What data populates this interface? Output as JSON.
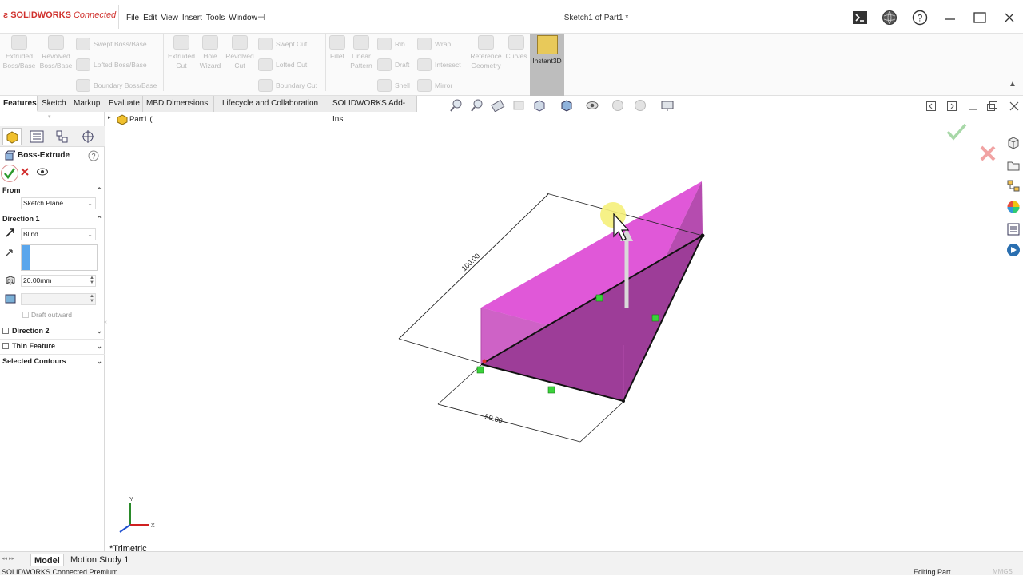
{
  "app": {
    "logo_brand": "SOLIDWORKS",
    "logo_suffix": "Connected",
    "doc_title": "Sketch1 of Part1 *"
  },
  "menu": [
    "File",
    "Edit",
    "View",
    "Insert",
    "Tools",
    "Window"
  ],
  "ribbon": {
    "extruded_boss": "Extruded Boss/Base",
    "revolved_boss": "Revolved Boss/Base",
    "swept_boss": "Swept Boss/Base",
    "lofted_boss": "Lofted Boss/Base",
    "boundary_boss": "Boundary Boss/Base",
    "extruded_cut": "Extruded Cut",
    "hole_wizard": "Hole Wizard",
    "revolved_cut": "Revolved Cut",
    "swept_cut": "Swept Cut",
    "lofted_cut": "Lofted Cut",
    "boundary_cut": "Boundary Cut",
    "fillet": "Fillet",
    "linear_pattern": "Linear Pattern",
    "rib": "Rib",
    "draft": "Draft",
    "shell": "Shell",
    "wrap": "Wrap",
    "intersect": "Intersect",
    "mirror": "Mirror",
    "reference_geometry": "Reference Geometry",
    "curves": "Curves",
    "instant3d": "Instant3D"
  },
  "tabs": [
    "Features",
    "Sketch",
    "Markup",
    "Evaluate",
    "MBD Dimensions",
    "Lifecycle and Collaboration",
    "SOLIDWORKS Add-Ins"
  ],
  "tree": {
    "root": "Part1 (..."
  },
  "property_manager": {
    "title": "Boss-Extrude",
    "from_label": "From",
    "from_value": "Sketch Plane",
    "direction1_label": "Direction 1",
    "end_condition": "Blind",
    "depth": "20.00mm",
    "draft_outward": "Draft outward",
    "direction2_label": "Direction 2",
    "thin_feature_label": "Thin Feature",
    "selected_contours_label": "Selected Contours"
  },
  "viewport": {
    "dim_length": "100.00",
    "dim_width": "50.00",
    "view_name": "*Trimetric",
    "axis_x": "X",
    "axis_y": "Y",
    "accent_color": "#e85ae0"
  },
  "bottom": {
    "tab_model": "Model",
    "tab_motion": "Motion Study 1",
    "status_left": "SOLIDWORKS Connected Premium",
    "status_right": "Editing Part",
    "units": "MMGS"
  }
}
